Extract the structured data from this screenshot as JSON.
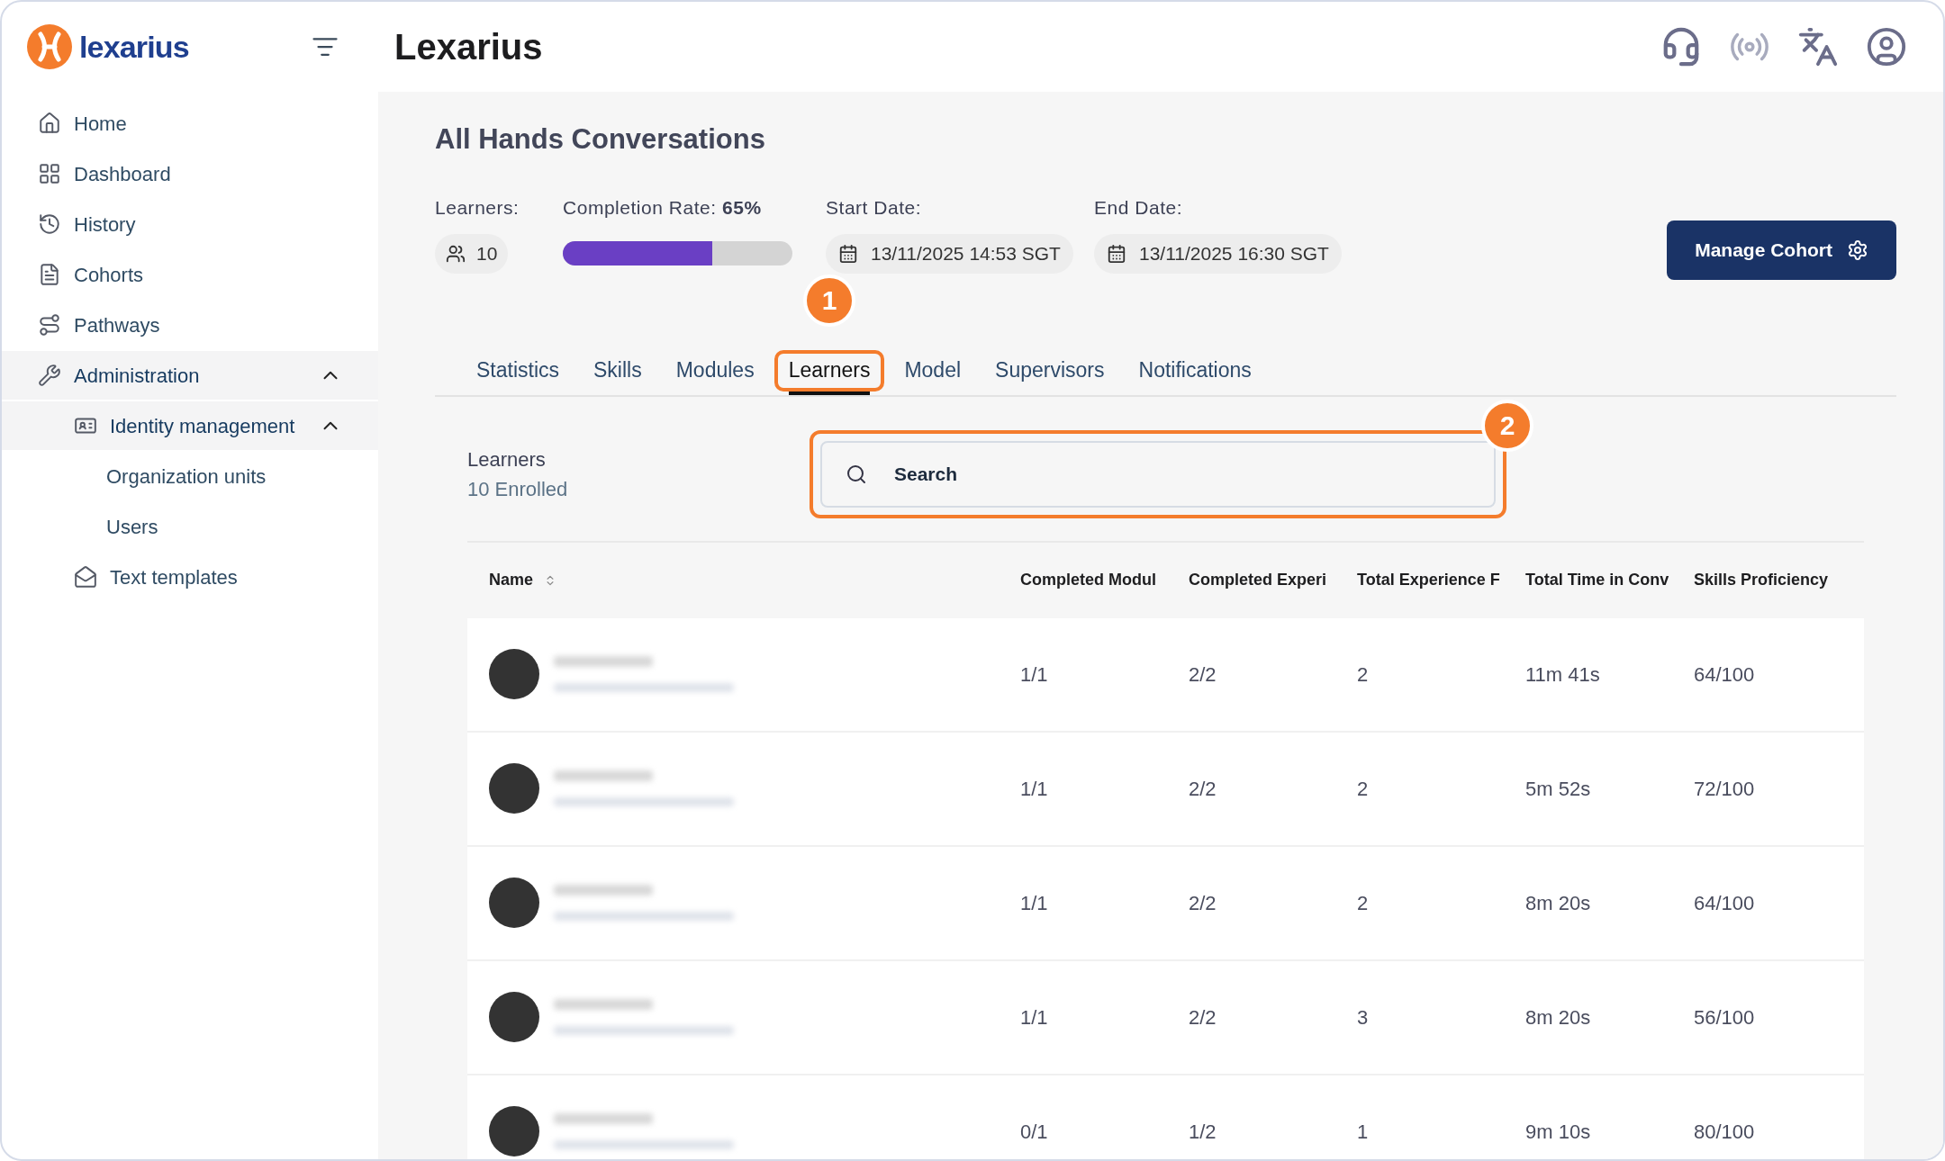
{
  "logo": {
    "text": "lexarius"
  },
  "sidebar": {
    "items": [
      {
        "label": "Home",
        "active": false
      },
      {
        "label": "Dashboard",
        "active": false
      },
      {
        "label": "History",
        "active": false
      },
      {
        "label": "Cohorts",
        "active": false
      },
      {
        "label": "Pathways",
        "active": false
      },
      {
        "label": "Administration",
        "active": true,
        "expanded": true,
        "children": [
          {
            "label": "Identity management",
            "active": true,
            "expanded": true,
            "children": [
              {
                "label": "Organization units",
                "active": false
              },
              {
                "label": "Users",
                "active": false
              }
            ]
          },
          {
            "label": "Text templates",
            "active": false
          }
        ]
      }
    ]
  },
  "header": {
    "title": "Lexarius"
  },
  "cohort": {
    "title": "All Hands Conversations",
    "learners": {
      "label": "Learners:",
      "count": "10"
    },
    "completion": {
      "label": "Completion Rate:",
      "value": "65%",
      "level": 0.65
    },
    "start": {
      "label": "Start Date:",
      "date": "13/11/2025 14:53 SGT"
    },
    "end": {
      "label": "End Date:",
      "date": "13/11/2025 16:30 SGT"
    },
    "manage_button": "Manage Cohort"
  },
  "tabs": [
    {
      "label": "Statistics",
      "selected": false
    },
    {
      "label": "Skills",
      "selected": false
    },
    {
      "label": "Modules",
      "selected": false
    },
    {
      "label": "Learners",
      "selected": true,
      "callout": "1"
    },
    {
      "label": "Model",
      "selected": false
    },
    {
      "label": "Supervisors",
      "selected": false
    },
    {
      "label": "Notifications",
      "selected": false
    }
  ],
  "learners_panel": {
    "title": "Learners",
    "subtitle": "10 Enrolled",
    "search": {
      "placeholder": "Search",
      "callout": "2"
    }
  },
  "table": {
    "columns": [
      "Name",
      "Completed Modul",
      "Completed Experi",
      "Total Experience F",
      "Total Time in Conv",
      "Skills Proficiency"
    ],
    "rows": [
      {
        "cells": [
          "",
          "1/1",
          "2/2",
          "2",
          "11m 41s",
          "64/100"
        ]
      },
      {
        "cells": [
          "",
          "1/1",
          "2/2",
          "2",
          "5m 52s",
          "72/100"
        ]
      },
      {
        "cells": [
          "",
          "1/1",
          "2/2",
          "2",
          "8m 20s",
          "64/100"
        ]
      },
      {
        "cells": [
          "",
          "1/1",
          "2/2",
          "3",
          "8m 20s",
          "56/100"
        ]
      },
      {
        "cells": [
          "",
          "0/1",
          "1/2",
          "1",
          "9m 10s",
          "80/100"
        ]
      }
    ]
  }
}
